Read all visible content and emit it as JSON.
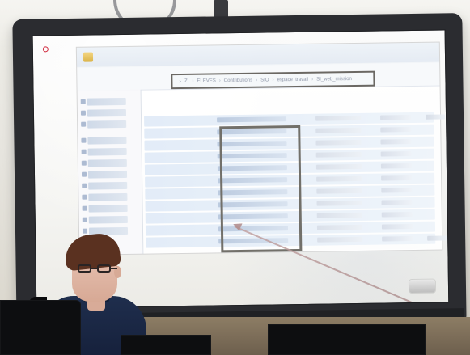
{
  "photo": {
    "screen": {
      "address_path": [
        "Z:",
        "ELEVES",
        "Contributions",
        "SIO",
        "espace_travail",
        "SI_web_mission"
      ]
    }
  }
}
